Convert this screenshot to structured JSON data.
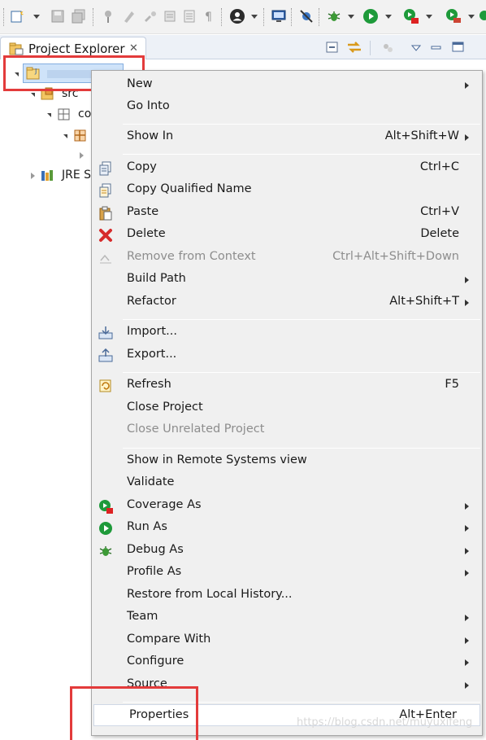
{
  "view": {
    "title": "Project Explorer",
    "close_glyph": "✕"
  },
  "tree": {
    "project_label": "",
    "src_label": "src",
    "package_label": "co",
    "jre_label": "JRE S"
  },
  "menu": {
    "items": [
      {
        "label": "New",
        "shortcut": "",
        "submenu": true,
        "icon": "none",
        "disabled": false
      },
      {
        "label": "Go Into",
        "shortcut": "",
        "submenu": false,
        "icon": "none",
        "disabled": false
      },
      {
        "label": "Show In",
        "shortcut": "Alt+Shift+W",
        "submenu": true,
        "icon": "none",
        "disabled": false
      },
      {
        "label": "Copy",
        "shortcut": "Ctrl+C",
        "submenu": false,
        "icon": "copy-icon",
        "disabled": false
      },
      {
        "label": "Copy Qualified Name",
        "shortcut": "",
        "submenu": false,
        "icon": "copy-qualified-icon",
        "disabled": false
      },
      {
        "label": "Paste",
        "shortcut": "Ctrl+V",
        "submenu": false,
        "icon": "paste-icon",
        "disabled": false
      },
      {
        "label": "Delete",
        "shortcut": "Delete",
        "submenu": false,
        "icon": "delete-icon",
        "disabled": false
      },
      {
        "label": "Remove from Context",
        "shortcut": "Ctrl+Alt+Shift+Down",
        "submenu": false,
        "icon": "remove-context-icon",
        "disabled": true
      },
      {
        "label": "Build Path",
        "shortcut": "",
        "submenu": true,
        "icon": "none",
        "disabled": false
      },
      {
        "label": "Refactor",
        "shortcut": "Alt+Shift+T",
        "submenu": true,
        "icon": "none",
        "disabled": false
      },
      {
        "label": "Import...",
        "shortcut": "",
        "submenu": false,
        "icon": "import-icon",
        "disabled": false
      },
      {
        "label": "Export...",
        "shortcut": "",
        "submenu": false,
        "icon": "export-icon",
        "disabled": false
      },
      {
        "label": "Refresh",
        "shortcut": "F5",
        "submenu": false,
        "icon": "refresh-icon",
        "disabled": false
      },
      {
        "label": "Close Project",
        "shortcut": "",
        "submenu": false,
        "icon": "none",
        "disabled": false
      },
      {
        "label": "Close Unrelated Project",
        "shortcut": "",
        "submenu": false,
        "icon": "none",
        "disabled": true
      },
      {
        "label": "Show in Remote Systems view",
        "shortcut": "",
        "submenu": false,
        "icon": "none",
        "disabled": false
      },
      {
        "label": "Validate",
        "shortcut": "",
        "submenu": false,
        "icon": "none",
        "disabled": false
      },
      {
        "label": "Coverage As",
        "shortcut": "",
        "submenu": true,
        "icon": "coverage-icon",
        "disabled": false
      },
      {
        "label": "Run As",
        "shortcut": "",
        "submenu": true,
        "icon": "run-icon",
        "disabled": false
      },
      {
        "label": "Debug As",
        "shortcut": "",
        "submenu": true,
        "icon": "debug-icon",
        "disabled": false
      },
      {
        "label": "Profile As",
        "shortcut": "",
        "submenu": true,
        "icon": "none",
        "disabled": false
      },
      {
        "label": "Restore from Local History...",
        "shortcut": "",
        "submenu": false,
        "icon": "none",
        "disabled": false
      },
      {
        "label": "Team",
        "shortcut": "",
        "submenu": true,
        "icon": "none",
        "disabled": false
      },
      {
        "label": "Compare With",
        "shortcut": "",
        "submenu": true,
        "icon": "none",
        "disabled": false
      },
      {
        "label": "Configure",
        "shortcut": "",
        "submenu": true,
        "icon": "none",
        "disabled": false
      },
      {
        "label": "Source",
        "shortcut": "",
        "submenu": true,
        "icon": "none",
        "disabled": false
      },
      {
        "label": "Properties",
        "shortcut": "Alt+Enter",
        "submenu": false,
        "icon": "none",
        "disabled": false
      }
    ]
  },
  "watermark": "https://blog.csdn.net/muyuxifeng",
  "colors": {
    "highlight_box": "#e33b3b",
    "menu_bg": "#f0f0f0",
    "disabled_text": "#8d8d8d"
  }
}
